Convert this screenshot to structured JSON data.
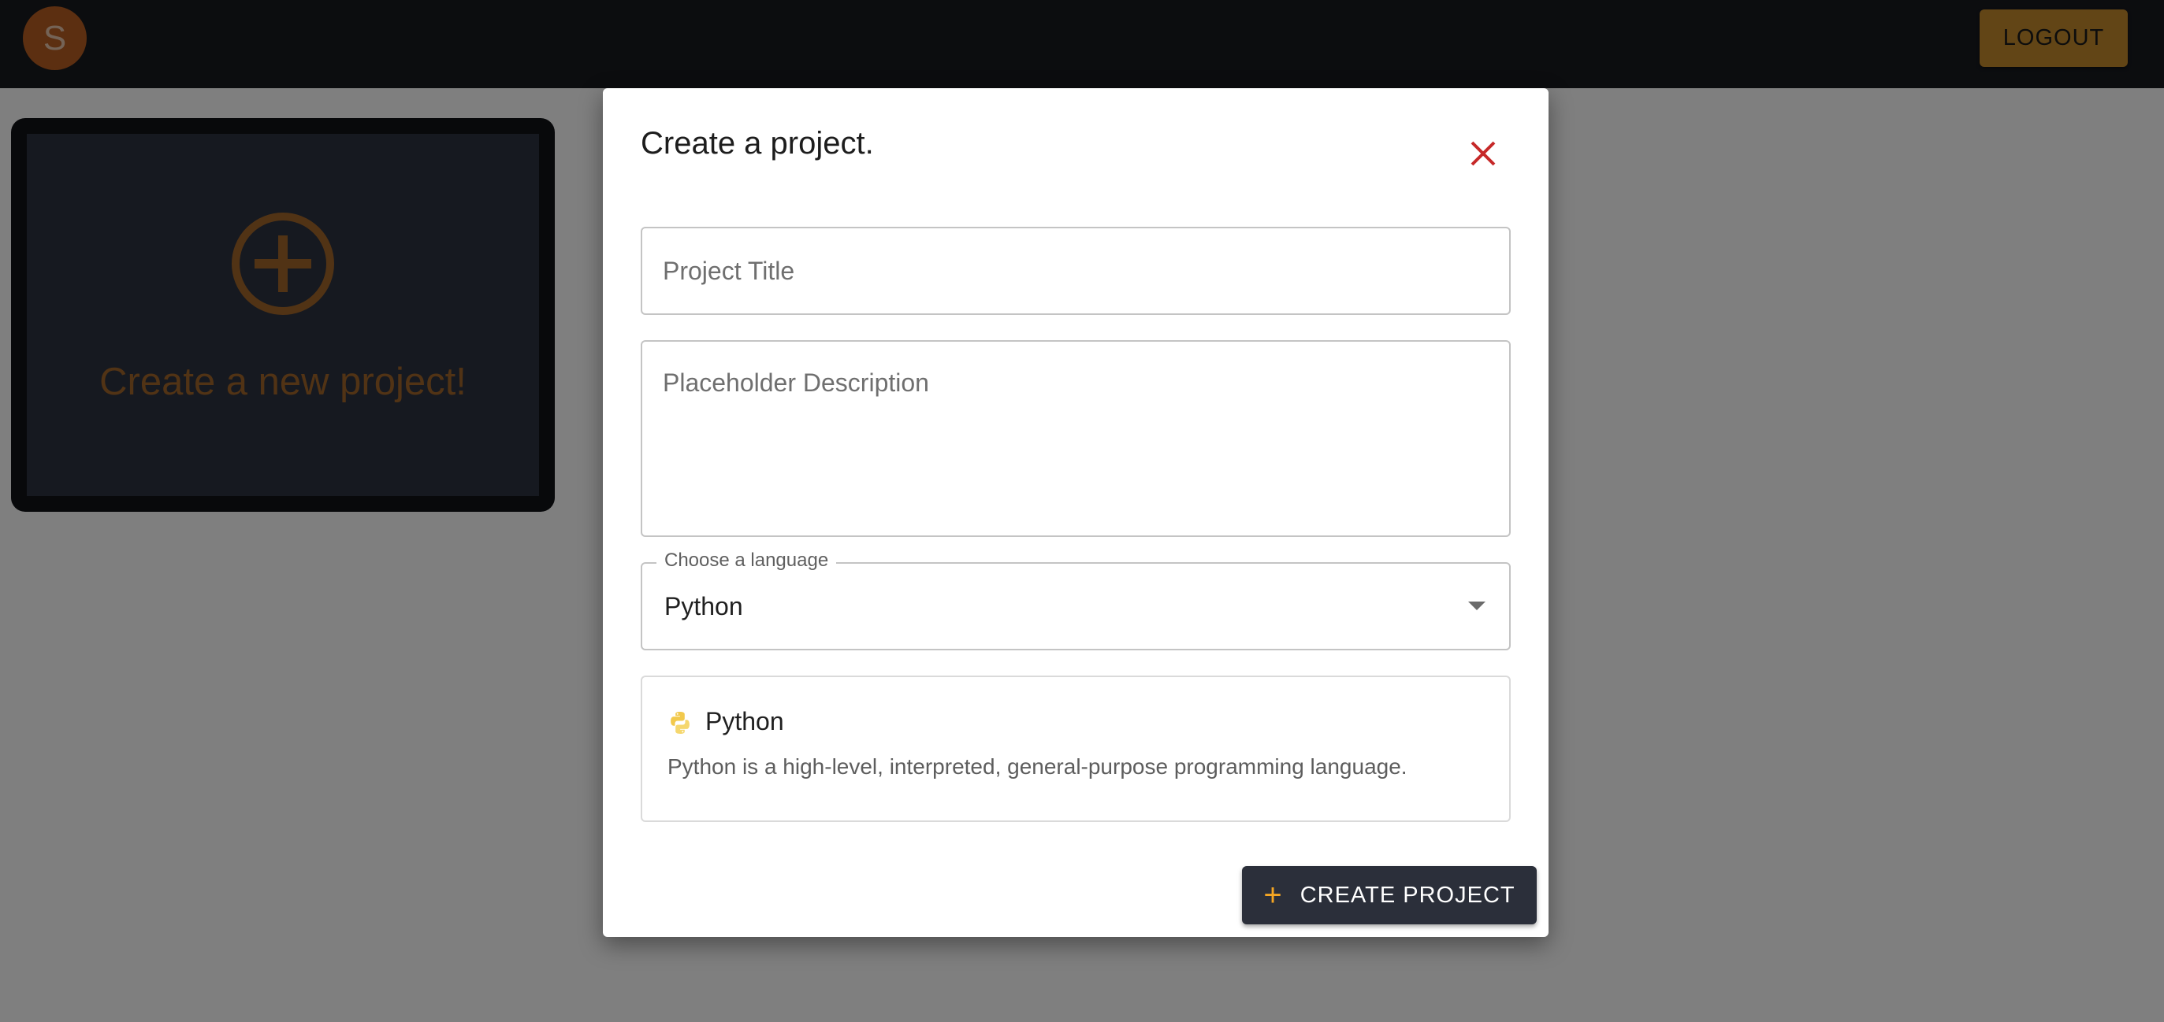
{
  "appbar": {
    "avatar_letter": "S",
    "logout_label": "LOGOUT"
  },
  "projects": {
    "new_project_card_label": "Create a new project!",
    "new_project_icon": "plus-circle-icon"
  },
  "dialog": {
    "title": "Create a project.",
    "close_icon": "close-icon",
    "project_title": {
      "value": "",
      "placeholder": "Project Title"
    },
    "description": {
      "value": "",
      "placeholder": "Placeholder Description"
    },
    "language_select": {
      "label": "Choose a language",
      "selected": "Python"
    },
    "language_info": {
      "icon": "python-icon",
      "name": "Python",
      "description": "Python is a high-level, interpreted, general-purpose programming language."
    },
    "create_button": {
      "icon": "plus-icon",
      "label": "CREATE PROJECT"
    }
  },
  "colors": {
    "appbar_bg": "#181a1f",
    "avatar": "#b85e22",
    "logout_bg": "#c58a2c",
    "card_bg": "#2d3240",
    "card_accent": "#a3672b",
    "close_icon": "#c62828",
    "create_button_bg": "#2b2f3a",
    "create_button_icon": "#f5a623"
  }
}
